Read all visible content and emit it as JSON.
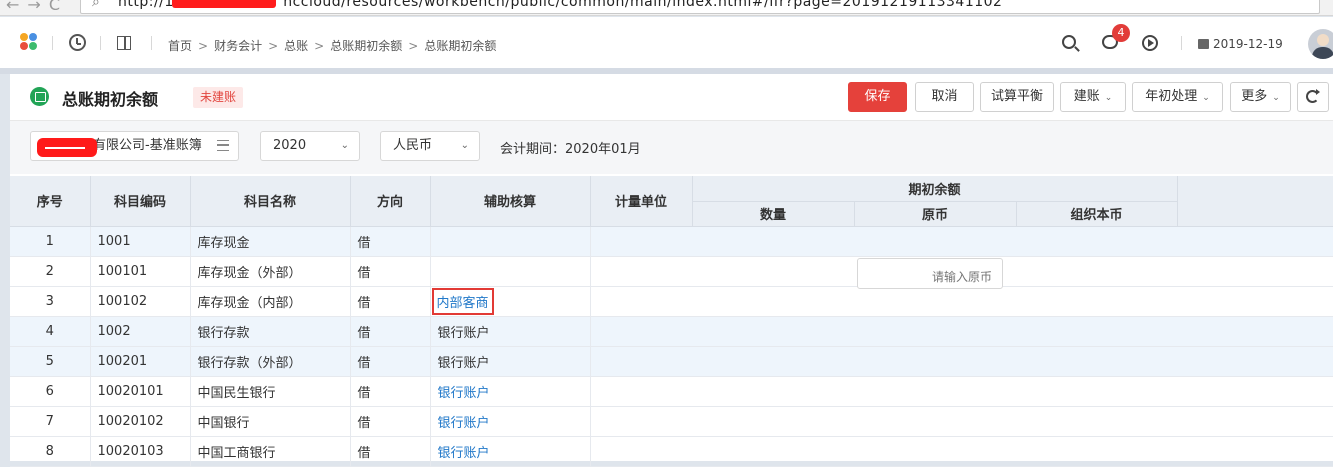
{
  "browser": {
    "url_start": "http://19",
    "url_end": "nccloud/resources/workbench/public/common/main/index.html#/ifr?page=20191219113341102"
  },
  "topnav": {
    "breadcrumbs": [
      "首页",
      "财务会计",
      "总账",
      "总账期初余额",
      "总账期初余额"
    ],
    "notification_count": "4",
    "date": "2019-12-19"
  },
  "header": {
    "title": "总账期初余额",
    "status": "未建账",
    "buttons": {
      "save": "保存",
      "cancel": "取消",
      "trial_balance": "试算平衡",
      "build": "建账",
      "year_start": "年初处理",
      "more": "更多"
    }
  },
  "filters": {
    "account_book": "有限公司-基准账簿",
    "year": "2020",
    "currency": "人民币",
    "period_label": "会计期间：2020年01月"
  },
  "table": {
    "headers": {
      "seq": "序号",
      "code": "科目编码",
      "name": "科目名称",
      "direction": "方向",
      "aux": "辅助核算",
      "unit": "计量单位",
      "opening_balance": "期初余额",
      "quantity": "数量",
      "original": "原币",
      "org_currency": "组织本币"
    },
    "rows": [
      {
        "seq": "1",
        "code": "1001",
        "name": "库存现金",
        "dir": "借",
        "aux": ""
      },
      {
        "seq": "2",
        "code": "100101",
        "name": "库存现金（外部）",
        "dir": "借",
        "aux": ""
      },
      {
        "seq": "3",
        "code": "100102",
        "name": "库存现金（内部）",
        "dir": "借",
        "aux": "内部客商"
      },
      {
        "seq": "4",
        "code": "1002",
        "name": "银行存款",
        "dir": "借",
        "aux": "银行账户"
      },
      {
        "seq": "5",
        "code": "100201",
        "name": "银行存款（外部）",
        "dir": "借",
        "aux": "银行账户"
      },
      {
        "seq": "6",
        "code": "10020101",
        "name": "中国民生银行",
        "dir": "借",
        "aux": "银行账户"
      },
      {
        "seq": "7",
        "code": "10020102",
        "name": "中国银行",
        "dir": "借",
        "aux": "银行账户"
      },
      {
        "seq": "8",
        "code": "10020103",
        "name": "中国工商银行",
        "dir": "借",
        "aux": "银行账户"
      }
    ],
    "input_placeholder": "请输入原币"
  }
}
